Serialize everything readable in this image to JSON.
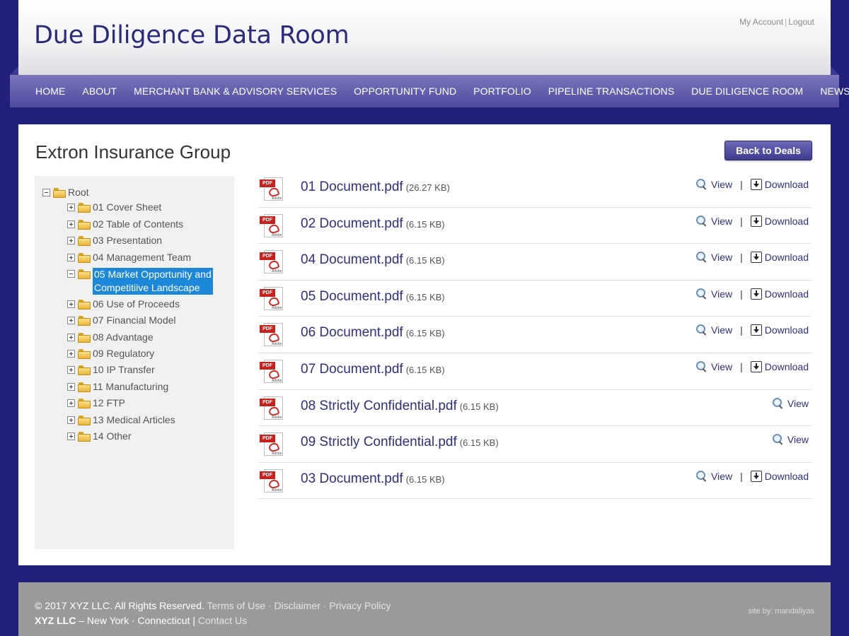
{
  "header": {
    "site_title": "Due Diligence Data Room",
    "my_account": "My Account",
    "separator": "|",
    "logout": "Logout"
  },
  "nav": [
    "HOME",
    "ABOUT",
    "MERCHANT BANK & ADVISORY SERVICES",
    "OPPORTUNITY FUND",
    "PORTFOLIO",
    "PIPELINE TRANSACTIONS",
    "DUE DILIGENCE ROOM",
    "NEWS"
  ],
  "page": {
    "title": "Extron Insurance Group",
    "back_button": "Back to Deals"
  },
  "tree": {
    "root": "Root",
    "folders": [
      {
        "label": "01 Cover Sheet",
        "expanded": false
      },
      {
        "label": "02 Table of Contents",
        "expanded": false
      },
      {
        "label": "03 Presentation",
        "expanded": false
      },
      {
        "label": "04 Management Team",
        "expanded": false
      },
      {
        "label": "05 Market Opportunity and",
        "label2": "Competitiive Landscape",
        "expanded": true,
        "selected": true
      },
      {
        "label": "06 Use of Proceeds",
        "expanded": false
      },
      {
        "label": "07 Financial Model",
        "expanded": false
      },
      {
        "label": "08 Advantage",
        "expanded": false
      },
      {
        "label": "09 Regulatory",
        "expanded": false
      },
      {
        "label": "10 IP Transfer",
        "expanded": false
      },
      {
        "label": "11 Manufacturing",
        "expanded": false
      },
      {
        "label": "12 FTP",
        "expanded": false
      },
      {
        "label": "13 Medical Articles",
        "expanded": false
      },
      {
        "label": "14 Other",
        "expanded": false
      }
    ]
  },
  "pdf_icon": {
    "label": "PDF",
    "brand": "Adobe"
  },
  "actions": {
    "view": "View",
    "download": "Download",
    "separator": "|"
  },
  "documents": [
    {
      "name": "01 Document.pdf",
      "size": "(26.27 KB)",
      "download": true
    },
    {
      "name": "02 Document.pdf",
      "size": "(6.15 KB)",
      "download": true
    },
    {
      "name": "04 Document.pdf",
      "size": "(6.15 KB)",
      "download": true
    },
    {
      "name": "05 Document.pdf",
      "size": "(6.15 KB)",
      "download": true
    },
    {
      "name": "06 Document.pdf",
      "size": "(6.15 KB)",
      "download": true
    },
    {
      "name": "07 Document.pdf",
      "size": "(6.15 KB)",
      "download": true
    },
    {
      "name": "08 Strictly Confidential.pdf",
      "size": "(6.15 KB)",
      "download": false
    },
    {
      "name": "09 Strictly Confidential.pdf",
      "size": "(6.15 KB)",
      "download": false
    },
    {
      "name": "03 Document.pdf",
      "size": "(6.15 KB)",
      "download": true
    }
  ],
  "footer": {
    "copyright": "© 2017 XYZ LLC. All Rights Reserved.",
    "terms": "Terms of Use",
    "dot": "·",
    "disclaimer": "Disclaimer",
    "privacy": "Privacy Policy",
    "company": "XYZ LLC",
    "dash": "–",
    "new_york": "New York",
    "connecticut": "Connecticut",
    "pipe": "|",
    "contact": "Contact Us",
    "site_by": "site by: mandaliyas"
  },
  "colors": {
    "background": "#22207a",
    "nav": "#5a57a8",
    "link": "#2f2f7e",
    "selected": "#1e88d8"
  }
}
